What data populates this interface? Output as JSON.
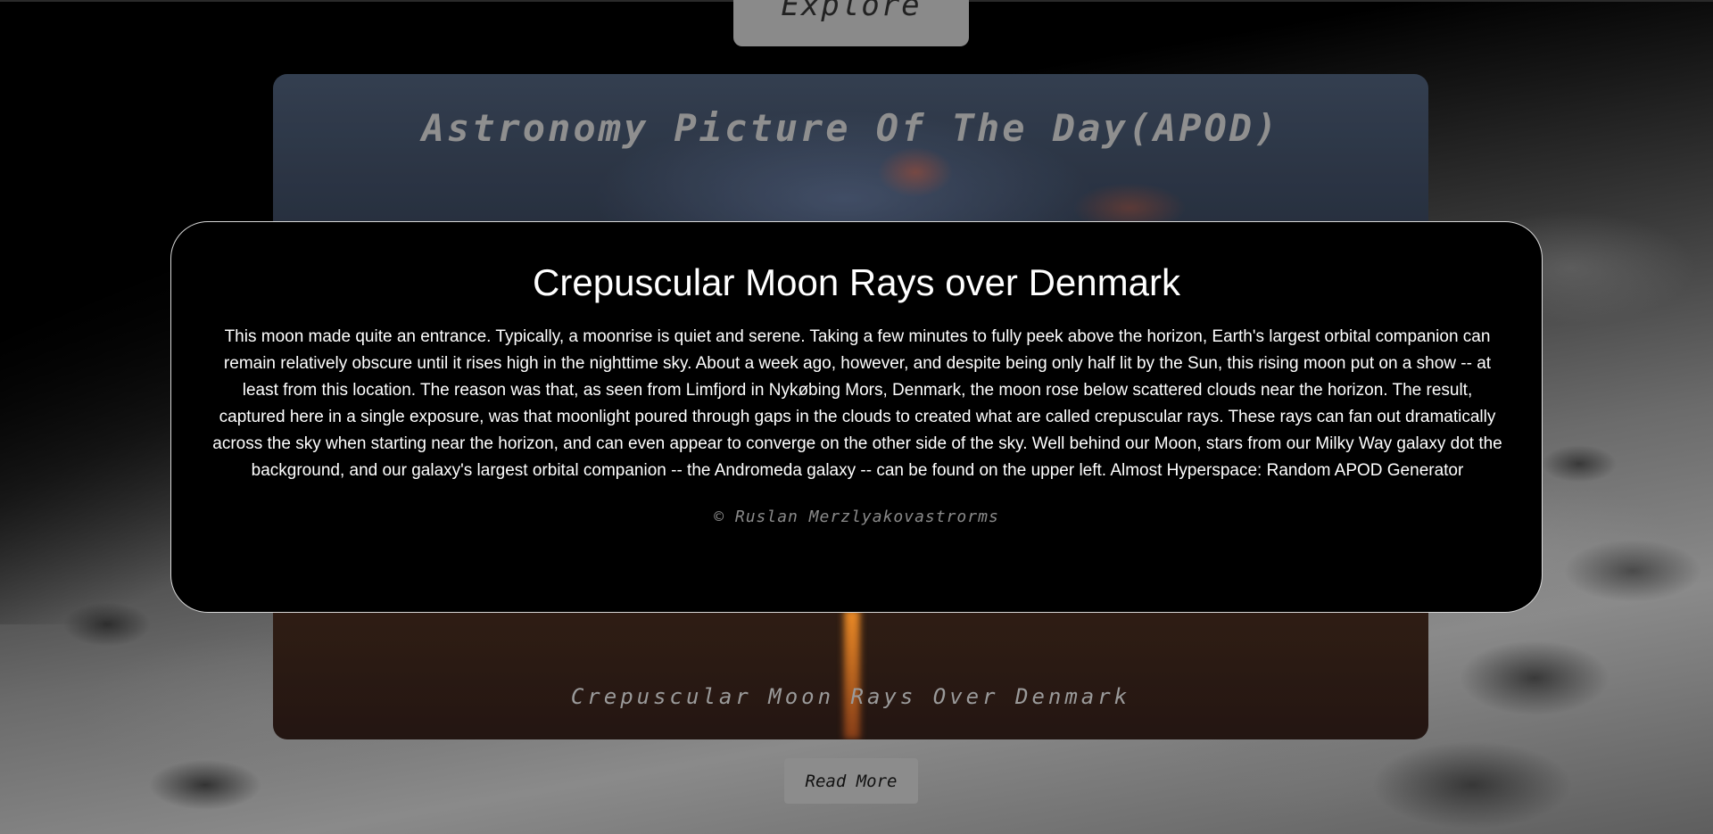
{
  "nav": {
    "explore_label": "Explore"
  },
  "apod": {
    "heading": "Astronomy Picture Of The Day(APOD)",
    "caption": "Crepuscular Moon Rays Over Denmark",
    "read_more_label": "Read More"
  },
  "modal": {
    "title": "Crepuscular Moon Rays over Denmark",
    "description": "This moon made quite an entrance. Typically, a moonrise is quiet and serene. Taking a few minutes to fully peek above the horizon, Earth's largest orbital companion can remain relatively obscure until it rises high in the nighttime sky. About a week ago, however, and despite being only half lit by the Sun, this rising moon put on a show -- at least from this location. The reason was that, as seen from Limfjord in Nykøbing Mors, Denmark, the moon rose below scattered clouds near the horizon. The result, captured here in a single exposure, was that moonlight poured through gaps in the clouds to created what are called crepuscular rays. These rays can fan out dramatically across the sky when starting near the horizon, and can even appear to converge on the other side of the sky. Well behind our Moon, stars from our Milky Way galaxy dot the background, and our galaxy's largest orbital companion -- the Andromeda galaxy -- can be found on the upper left. Almost Hyperspace: Random APOD Generator",
    "credit": "© Ruslan Merzlyakovastrorms"
  }
}
